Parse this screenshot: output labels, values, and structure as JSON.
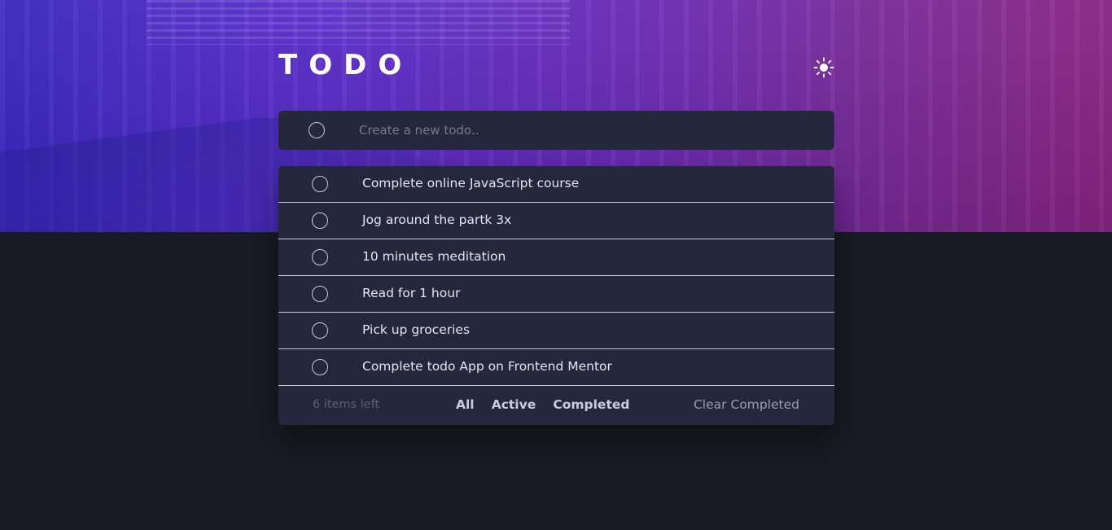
{
  "app": {
    "title": "TODO",
    "theme_icon": "sun-icon"
  },
  "new_todo": {
    "placeholder": "Create a new todo.."
  },
  "todos": [
    {
      "text": "Complete online JavaScript course",
      "completed": false
    },
    {
      "text": "Jog around the partk 3x",
      "completed": false
    },
    {
      "text": "10 minutes meditation",
      "completed": false
    },
    {
      "text": "Read for 1 hour",
      "completed": false
    },
    {
      "text": "Pick up groceries",
      "completed": false
    },
    {
      "text": "Complete todo App on Frontend Mentor",
      "completed": false
    }
  ],
  "footer": {
    "items_left": "6 items left",
    "filters": [
      "All",
      "Active",
      "Completed"
    ],
    "clear_label": "Clear Completed"
  },
  "colors": {
    "background": "#191a23",
    "card": "#25273c",
    "gradient_start": "#3b27c4",
    "gradient_end": "#8b2587",
    "text": "#e4e5f1"
  }
}
